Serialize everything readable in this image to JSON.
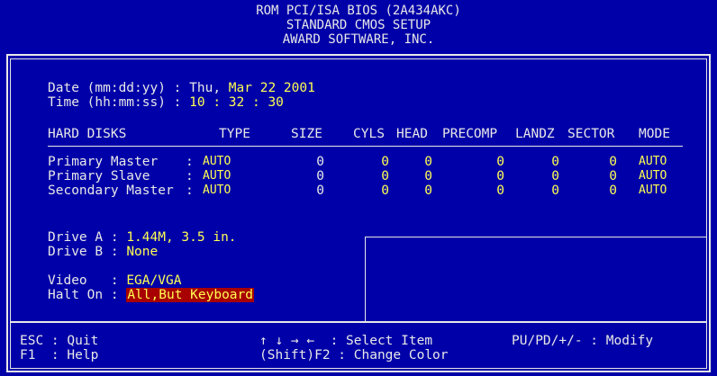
{
  "header": {
    "line1": "ROM PCI/ISA BIOS (2A434AKC)",
    "line2": "STANDARD CMOS SETUP",
    "line3": "AWARD SOFTWARE, INC."
  },
  "datetime": {
    "date_label": "Date (mm:dd:yy) : ",
    "date_day": "Thu, ",
    "date_value": "Mar 22 2001",
    "time_label": "Time (hh:mm:ss) : ",
    "time_value": "10 : 32 : 30"
  },
  "disks": {
    "columns": [
      "HARD DISKS",
      "TYPE",
      "SIZE",
      "CYLS",
      "HEAD",
      "PRECOMP",
      "LANDZ",
      "SECTOR",
      "MODE"
    ],
    "rows": [
      {
        "name": "Primary Master",
        "sep": ": ",
        "type": "AUTO",
        "size": "0",
        "cyls": "0",
        "head": "0",
        "precomp": "0",
        "landz": "0",
        "sector": "0",
        "mode": "AUTO"
      },
      {
        "name": "Primary Slave",
        "sep": ": ",
        "type": "AUTO",
        "size": "0",
        "cyls": "0",
        "head": "0",
        "precomp": "0",
        "landz": "0",
        "sector": "0",
        "mode": "AUTO"
      },
      {
        "name": "Secondary Master",
        "sep": ": ",
        "type": "AUTO",
        "size": "0",
        "cyls": "0",
        "head": "0",
        "precomp": "0",
        "landz": "0",
        "sector": "0",
        "mode": "AUTO"
      }
    ]
  },
  "drives": {
    "a_label": "Drive A : ",
    "a_value": "1.44M, 3.5 in.",
    "b_label": "Drive B : ",
    "b_value": "None",
    "video_label": "Video   : ",
    "video_value": "EGA/VGA",
    "halt_label": "Halt On : ",
    "halt_value": "All,But Keyboard"
  },
  "footer": {
    "esc": "ESC : Quit",
    "f1": "F1  : Help",
    "arrows": "↑ ↓ → ←",
    "select": "  : Select Item",
    "shift": "(Shift)F2 : Change Color",
    "modify": "PU/PD/+/- : Modify"
  }
}
